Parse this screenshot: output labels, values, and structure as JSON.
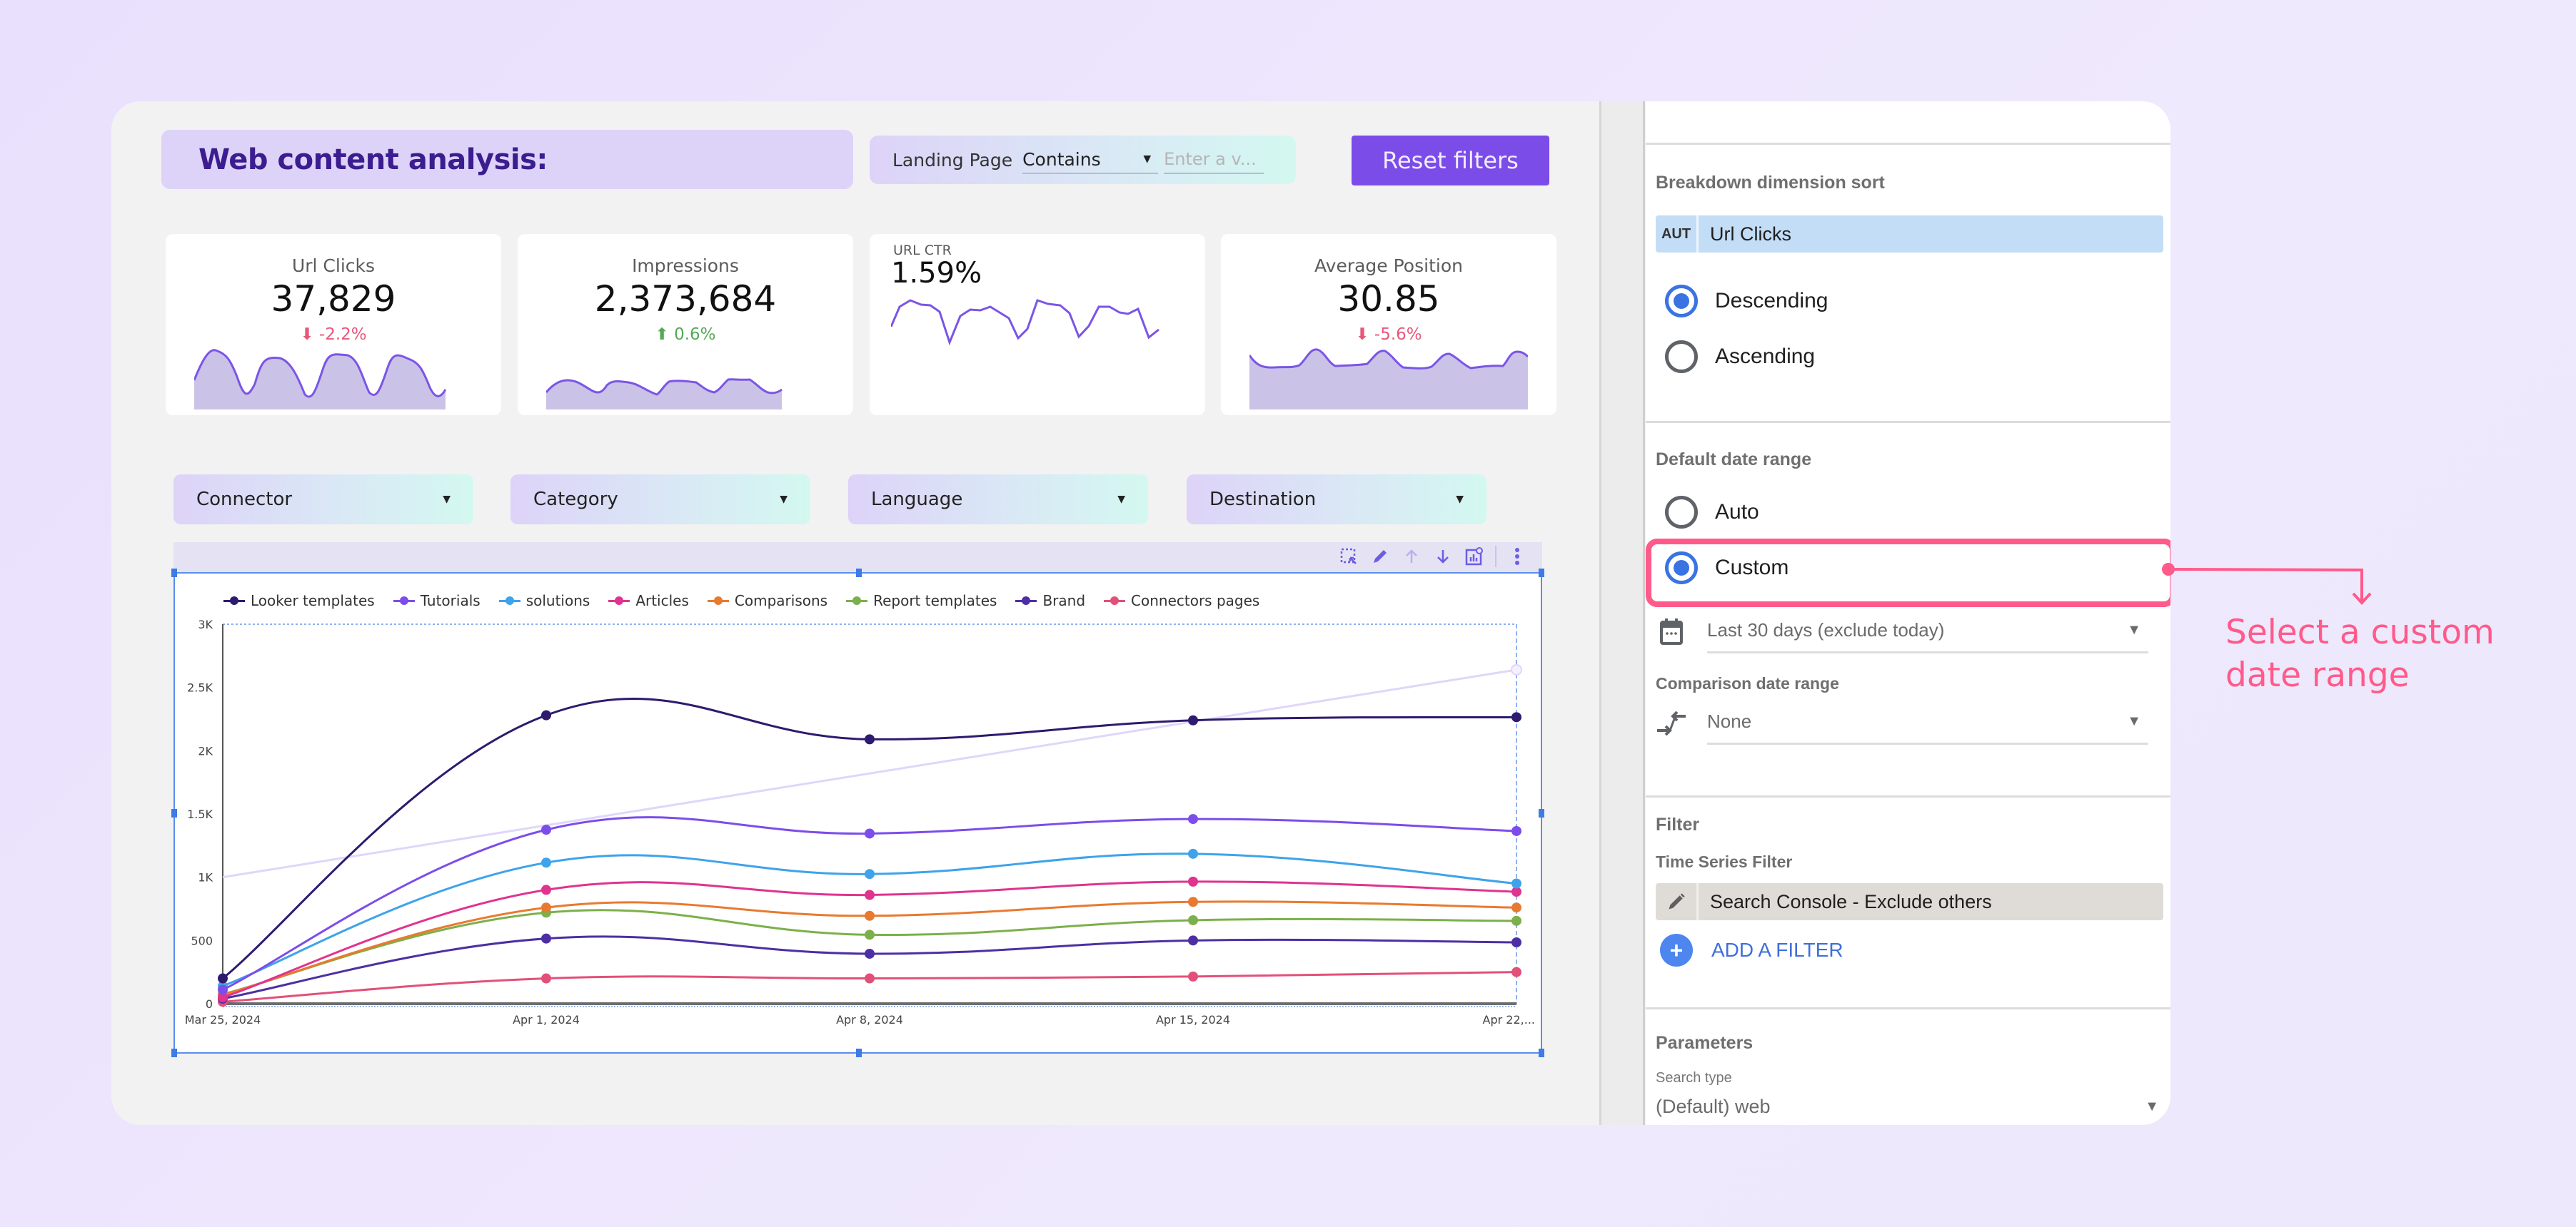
{
  "header": {
    "title": "Web content analysis:",
    "landing_filter": {
      "label": "Landing Page",
      "operator": "Contains",
      "input_placeholder": "Enter a v..."
    },
    "reset_button": "Reset filters"
  },
  "kpis": [
    {
      "label": "Url Clicks",
      "value": "37,829",
      "delta": "-2.2%",
      "direction": "down"
    },
    {
      "label": "Impressions",
      "value": "2,373,684",
      "delta": "0.6%",
      "direction": "up"
    },
    {
      "label": "URL CTR",
      "value": "1.59%",
      "delta": "",
      "direction": ""
    },
    {
      "label": "Average Position",
      "value": "30.85",
      "delta": "-5.6%",
      "direction": "down"
    }
  ],
  "dropdowns": [
    {
      "label": "Connector"
    },
    {
      "label": "Category"
    },
    {
      "label": "Language"
    },
    {
      "label": "Destination"
    }
  ],
  "toolbar_icons": [
    "select-area-icon",
    "edit-icon",
    "move-up-icon",
    "move-down-icon",
    "chart-settings-icon",
    "more-vert-icon"
  ],
  "chart_data": {
    "type": "line",
    "title": "",
    "xlabel": "",
    "ylabel": "",
    "x": [
      "Mar 25, 2024",
      "Apr 1, 2024",
      "Apr 8, 2024",
      "Apr 15, 2024",
      "Apr 22,..."
    ],
    "ylim": [
      0,
      3000
    ],
    "yticks": [
      {
        "value": 0,
        "label": "0"
      },
      {
        "value": 500,
        "label": "500"
      },
      {
        "value": 1000,
        "label": "1K"
      },
      {
        "value": 1500,
        "label": "1.5K"
      },
      {
        "value": 2000,
        "label": "2K"
      },
      {
        "value": 2500,
        "label": "2.5K"
      },
      {
        "value": 3000,
        "label": "3K"
      }
    ],
    "legend_position": "top",
    "series": [
      {
        "name": "Looker templates",
        "color": "#2e1a6e",
        "values": [
          200,
          2280,
          2090,
          2240,
          2265
        ]
      },
      {
        "name": "Tutorials",
        "color": "#7c4dea",
        "values": [
          110,
          1375,
          1345,
          1460,
          1365
        ]
      },
      {
        "name": "solutions",
        "color": "#3ea3ea",
        "values": [
          140,
          1115,
          1025,
          1185,
          950
        ]
      },
      {
        "name": "Articles",
        "color": "#e0338f",
        "values": [
          50,
          900,
          860,
          965,
          885
        ]
      },
      {
        "name": "Comparisons",
        "color": "#e87a30",
        "values": [
          70,
          760,
          695,
          805,
          760
        ]
      },
      {
        "name": "Report templates",
        "color": "#7cb04a",
        "values": [
          75,
          720,
          545,
          660,
          655
        ]
      },
      {
        "name": "Brand",
        "color": "#4d2fa3",
        "values": [
          40,
          515,
          395,
          500,
          485
        ]
      },
      {
        "name": "Connectors pages",
        "color": "#e2507a",
        "values": [
          15,
          200,
          200,
          215,
          250
        ]
      }
    ],
    "trendline": {
      "color": "#e0d6fb",
      "values": [
        1000,
        2640
      ]
    }
  },
  "panel": {
    "breakdown_sort": {
      "heading": "Breakdown dimension sort",
      "chip_tag": "AUT",
      "chip_text": "Url Clicks",
      "options": [
        {
          "label": "Descending",
          "selected": true
        },
        {
          "label": "Ascending",
          "selected": false
        }
      ]
    },
    "default_date_range": {
      "heading": "Default date range",
      "options": [
        {
          "label": "Auto",
          "selected": false
        },
        {
          "label": "Custom",
          "selected": true
        }
      ],
      "range_value": "Last 30 days (exclude today)"
    },
    "comparison_date_range": {
      "heading": "Comparison date range",
      "value": "None"
    },
    "filter": {
      "heading": "Filter",
      "subheading": "Time Series Filter",
      "chip_text": "Search Console - Exclude others",
      "add_label": "ADD A FILTER"
    },
    "parameters": {
      "heading": "Parameters",
      "search_type_label": "Search type",
      "search_type_value": "(Default) web"
    }
  },
  "annotation": {
    "line1": "Select a custom",
    "line2": "date range",
    "color": "#ff5a8a"
  }
}
